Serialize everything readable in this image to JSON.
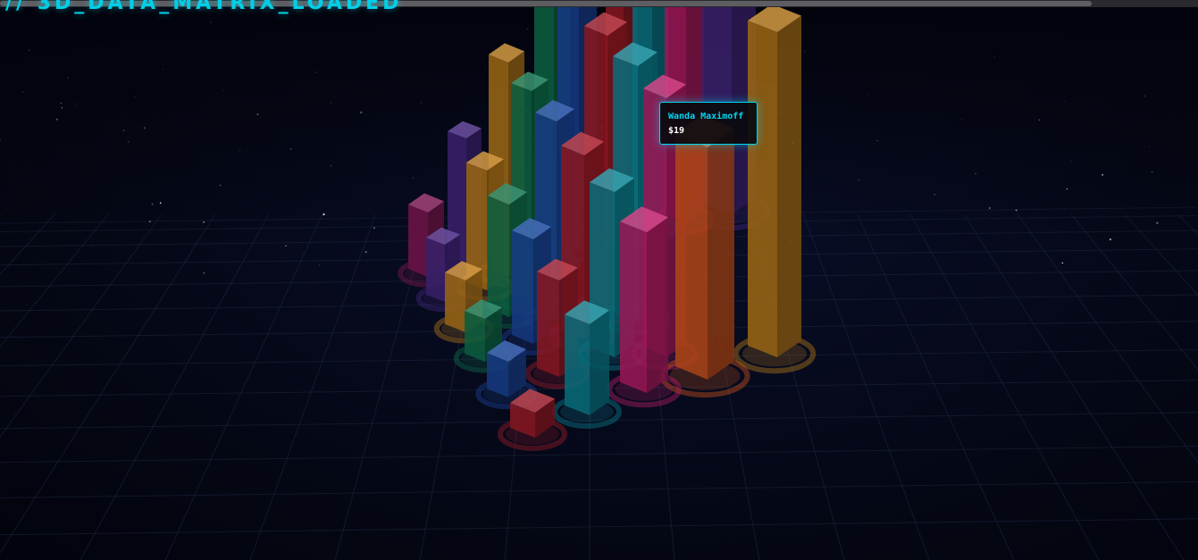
{
  "overlay": {
    "title": "// 3D_DATA_MATRIX_LOADED"
  },
  "tooltip": {
    "name": "Wanda Maximoff",
    "value": "$19"
  },
  "colors": {
    "background": "#03040f",
    "accent": "#00d6ef",
    "grid_line": "#1e2a44",
    "palette": [
      "#8e1a5c",
      "#4a2a8a",
      "#c8841a",
      "#0f7a52",
      "#1c4aa8",
      "#b01e2a",
      "#0a8c9c",
      "#c81e6e",
      "#e05a1c"
    ]
  }
}
